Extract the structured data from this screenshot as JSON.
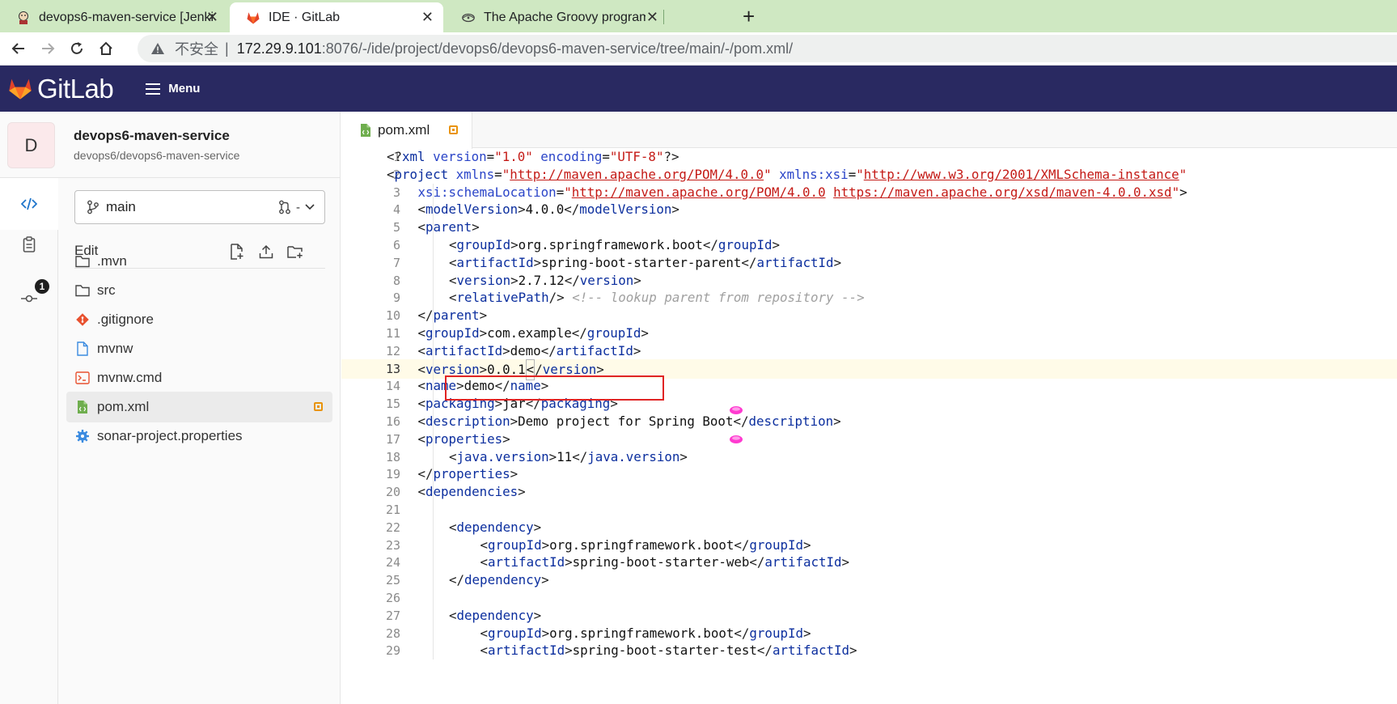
{
  "browser": {
    "tabs": [
      {
        "title": "devops6-maven-service [Jenki",
        "icon": "jenkins-icon",
        "active": false
      },
      {
        "title": "IDE · GitLab",
        "icon": "gitlab-icon",
        "active": true
      },
      {
        "title": "The Apache Groovy programm",
        "icon": "groovy-icon",
        "active": false
      }
    ],
    "new_tab_label": "+",
    "address": {
      "security_label": "不安全",
      "separator": "|",
      "host": "172.29.9.101",
      "path": ":8076/-/ide/project/devops6/devops6-maven-service/tree/main/-/pom.xml/"
    }
  },
  "gitlab": {
    "brand": "GitLab",
    "menu_label": "Menu",
    "header_color": "#292961",
    "project": {
      "avatar_letter": "D",
      "name": "devops6-maven-service",
      "path": "devops6/devops6-maven-service"
    },
    "rail": {
      "commit_badge": "1"
    },
    "branch": {
      "name": "main",
      "mr_label": "-"
    },
    "file_panel": {
      "edit_label": "Edit",
      "files": [
        {
          "name": ".mvn",
          "icon": "folder-icon"
        },
        {
          "name": "src",
          "icon": "folder-icon"
        },
        {
          "name": ".gitignore",
          "icon": "git-icon"
        },
        {
          "name": "mvnw",
          "icon": "file-icon"
        },
        {
          "name": "mvnw.cmd",
          "icon": "terminal-file-icon"
        },
        {
          "name": "pom.xml",
          "icon": "xml-file-icon"
        },
        {
          "name": "sonar-project.properties",
          "icon": "gear-file-icon"
        }
      ]
    },
    "editor": {
      "tab_title": "pom.xml",
      "current_line": 13,
      "lines": [
        {
          "n": "1",
          "indent": 0,
          "text": "<?xml version=\"1.0\" encoding=\"UTF-8\"?>"
        },
        {
          "n": "2",
          "indent": 0,
          "text": "<project xmlns=\"http://maven.apache.org/POM/4.0.0\" xmlns:xsi=\"http://www.w3.org/2001/XMLSchema-instance\""
        },
        {
          "n": "3",
          "indent": 1,
          "text": "xsi:schemaLocation=\"http://maven.apache.org/POM/4.0.0 https://maven.apache.org/xsd/maven-4.0.0.xsd\">"
        },
        {
          "n": "4",
          "indent": 1,
          "text": "<modelVersion>4.0.0</modelVersion>"
        },
        {
          "n": "5",
          "indent": 1,
          "text": "<parent>"
        },
        {
          "n": "6",
          "indent": 2,
          "text": "<groupId>org.springframework.boot</groupId>"
        },
        {
          "n": "7",
          "indent": 2,
          "text": "<artifactId>spring-boot-starter-parent</artifactId>"
        },
        {
          "n": "8",
          "indent": 2,
          "text": "<version>2.7.12</version>"
        },
        {
          "n": "9",
          "indent": 2,
          "text": "<relativePath/> <!-- lookup parent from repository -->"
        },
        {
          "n": "10",
          "indent": 1,
          "text": "</parent>"
        },
        {
          "n": "11",
          "indent": 1,
          "text": "<groupId>com.example</groupId>"
        },
        {
          "n": "12",
          "indent": 1,
          "text": "<artifactId>demo</artifactId>"
        },
        {
          "n": "13",
          "indent": 1,
          "text": "<version>0.0.1</version>"
        },
        {
          "n": "14",
          "indent": 1,
          "text": "<name>demo</name>"
        },
        {
          "n": "15",
          "indent": 1,
          "text": "<packaging>jar</packaging>"
        },
        {
          "n": "16",
          "indent": 1,
          "text": "<description>Demo project for Spring Boot</description>"
        },
        {
          "n": "17",
          "indent": 1,
          "text": "<properties>"
        },
        {
          "n": "18",
          "indent": 2,
          "text": "<java.version>11</java.version>"
        },
        {
          "n": "19",
          "indent": 1,
          "text": "</properties>"
        },
        {
          "n": "20",
          "indent": 1,
          "text": "<dependencies>"
        },
        {
          "n": "21",
          "indent": 0,
          "text": ""
        },
        {
          "n": "22",
          "indent": 2,
          "text": "<dependency>"
        },
        {
          "n": "23",
          "indent": 3,
          "text": "<groupId>org.springframework.boot</groupId>"
        },
        {
          "n": "24",
          "indent": 3,
          "text": "<artifactId>spring-boot-starter-web</artifactId>"
        },
        {
          "n": "25",
          "indent": 2,
          "text": "</dependency>"
        },
        {
          "n": "26",
          "indent": 0,
          "text": ""
        },
        {
          "n": "27",
          "indent": 2,
          "text": "<dependency>"
        },
        {
          "n": "28",
          "indent": 3,
          "text": "<groupId>org.springframework.boot</groupId>"
        },
        {
          "n": "29",
          "indent": 3,
          "text": "<artifactId>spring-boot-starter-test</artifactId>"
        }
      ]
    }
  }
}
